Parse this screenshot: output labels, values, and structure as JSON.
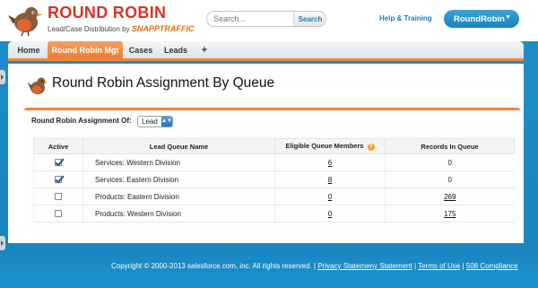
{
  "header": {
    "logo_title": "ROUND ROBIN",
    "logo_subtitle": "Lead/Case Distribution by",
    "logo_brand": "SNAPPTRAFFIC",
    "search_placeholder": "Search...",
    "search_button": "Search",
    "help_link": "Help & Training",
    "app_menu": "RoundRobin"
  },
  "tabs": [
    {
      "label": "Home",
      "active": false
    },
    {
      "label": "Round Robin Mgt",
      "active": true
    },
    {
      "label": "Cases",
      "active": false
    },
    {
      "label": "Leads",
      "active": false
    },
    {
      "label": "+",
      "active": false
    }
  ],
  "page": {
    "title": "Round Robin Assignment By Queue",
    "filter_label": "Round Robin Assignment Of:",
    "filter_value": "Lead"
  },
  "table": {
    "headers": [
      "Active",
      "Lead Queue Name",
      "Eligible Queue Members",
      "Records In Queue"
    ],
    "rows": [
      {
        "active": true,
        "name": "Services: Western Division",
        "members": "6",
        "records": "0",
        "records_link": false
      },
      {
        "active": true,
        "name": "Services: Eastern Division",
        "members": "8",
        "records": "0",
        "records_link": false
      },
      {
        "active": false,
        "name": "Products: Eastern Division",
        "members": "0",
        "records": "269",
        "records_link": true
      },
      {
        "active": false,
        "name": "Products: Western Division",
        "members": "0",
        "records": "175",
        "records_link": true
      }
    ]
  },
  "footer": {
    "copyright": "Copyright © 2000-2013 salesforce.com, inc. All rights reserved. |",
    "privacy": "Privacy Statemeny Statement",
    "terms": "Terms of Use",
    "compliance": "508 Compliance",
    "sep": "|"
  },
  "colors": {
    "accent_orange": "#f0873a",
    "brand_blue": "#1f8fc9",
    "logo_red": "#d7342a"
  },
  "icons": {
    "logo": "robin-bird-icon",
    "info": "info-icon",
    "checkbox": "checkbox-icon"
  }
}
